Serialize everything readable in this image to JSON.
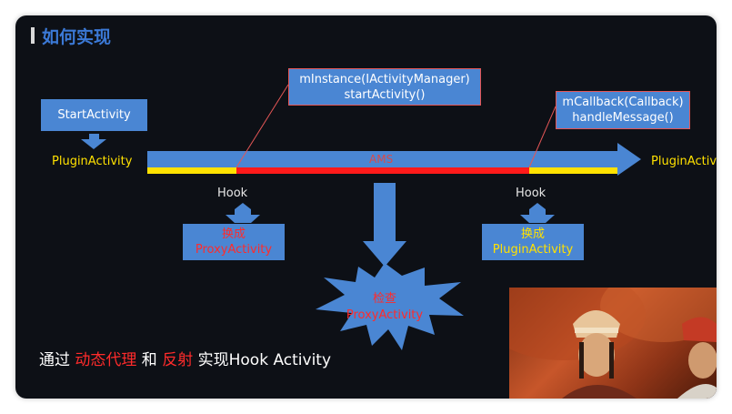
{
  "slide": {
    "title": "如何实现",
    "start_box": "StartActivity",
    "plugin_left": "PluginActivity",
    "plugin_right": "PluginActiv",
    "ams_label": "AMS",
    "left_callout": {
      "line1": "mInstance(IActivityManager)",
      "line2": "startActivity()"
    },
    "right_callout": {
      "line1": "mCallback(Callback)",
      "line2": "handleMessage()"
    },
    "hook_left": "Hook",
    "hook_right": "Hook",
    "left_swap": {
      "line1": "换成",
      "line2": "ProxyActivity"
    },
    "check_burst": {
      "line1": "检查",
      "line2": "ProxyActivity"
    },
    "right_swap": {
      "line1": "换成",
      "line2": "PluginActivity"
    },
    "bottom_caption": {
      "part1": "通过 ",
      "part2": "动态代理",
      "part3": " 和 ",
      "part4": "反射",
      "part5": " 实现Hook Activity"
    }
  },
  "colors": {
    "box_blue": "#4a86d3",
    "yellow": "#ffe100",
    "red": "#ff2b2b",
    "title_blue": "#3b79d6",
    "background": "#0d1016"
  }
}
